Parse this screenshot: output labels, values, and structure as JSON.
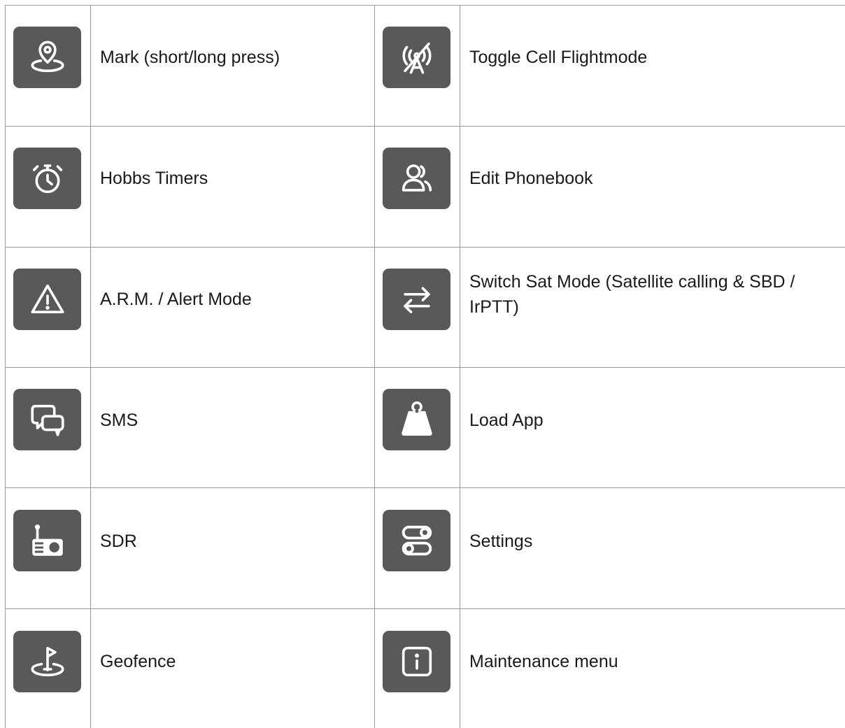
{
  "colors": {
    "tile": "#595959",
    "icon": "#ffffff",
    "grid_line": "#9a9a9a",
    "text": "#1a1a1a"
  },
  "rows": [
    {
      "left": {
        "icon": "map-pin-icon",
        "label": "Mark (short/long press)"
      },
      "right": {
        "icon": "no-signal-icon",
        "label": "Toggle Cell Flightmode"
      }
    },
    {
      "left": {
        "icon": "stopwatch-icon",
        "label": "Hobbs Timers"
      },
      "right": {
        "icon": "contacts-icon",
        "label": "Edit Phonebook"
      }
    },
    {
      "left": {
        "icon": "warning-icon",
        "label": "A.R.M. / Alert Mode"
      },
      "right": {
        "icon": "swap-arrows-icon",
        "label": "Switch Sat Mode (Satellite calling & SBD / IrPTT)"
      }
    },
    {
      "left": {
        "icon": "chat-bubbles-icon",
        "label": "SMS"
      },
      "right": {
        "icon": "shopping-bag-icon",
        "label": "Load App"
      }
    },
    {
      "left": {
        "icon": "radio-icon",
        "label": "SDR"
      },
      "right": {
        "icon": "toggles-icon",
        "label": "Settings"
      }
    },
    {
      "left": {
        "icon": "flag-pin-icon",
        "label": "Geofence"
      },
      "right": {
        "icon": "info-icon",
        "label": "Maintenance menu"
      }
    }
  ]
}
